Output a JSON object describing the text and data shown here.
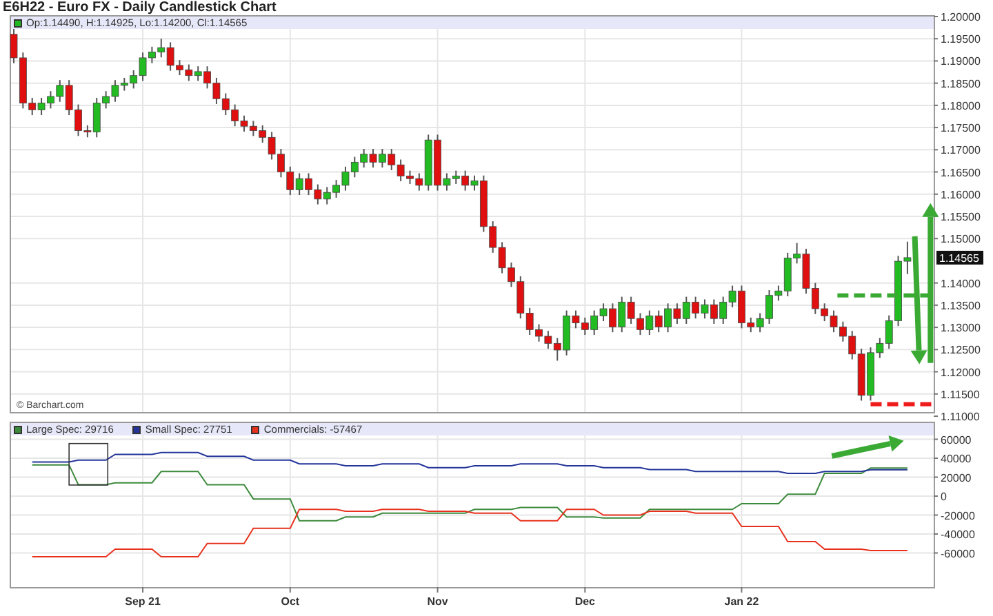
{
  "title": "E6H22 - Euro FX - Daily Candlestick Chart",
  "price_panel": {
    "legend": "Op:1.14490, H:1.14925, Lo:1.14200, Cl:1.14565",
    "credit": "© Barchart.com",
    "chart_data": {
      "type": "candlestick",
      "grid": true,
      "ylim": [
        1.11,
        1.2
      ],
      "yticks": [
        {
          "value": 1.2,
          "label": "1.20000"
        },
        {
          "value": 1.195,
          "label": "1.19500"
        },
        {
          "value": 1.19,
          "label": "1.19000"
        },
        {
          "value": 1.185,
          "label": "1.18500"
        },
        {
          "value": 1.18,
          "label": "1.18000"
        },
        {
          "value": 1.175,
          "label": "1.17500"
        },
        {
          "value": 1.17,
          "label": "1.17000"
        },
        {
          "value": 1.165,
          "label": "1.16500"
        },
        {
          "value": 1.16,
          "label": "1.16000"
        },
        {
          "value": 1.155,
          "label": "1.15500"
        },
        {
          "value": 1.15,
          "label": "1.15000"
        },
        {
          "value": 1.14,
          "label": "1.14000"
        },
        {
          "value": 1.135,
          "label": "1.13500"
        },
        {
          "value": 1.13,
          "label": "1.13000"
        },
        {
          "value": 1.125,
          "label": "1.12500"
        },
        {
          "value": 1.12,
          "label": "1.12000"
        },
        {
          "value": 1.115,
          "label": "1.11500"
        },
        {
          "value": 1.11,
          "label": "1.11000"
        }
      ],
      "ohlc": [
        [
          1.196,
          1.1975,
          1.1895,
          1.1907
        ],
        [
          1.1907,
          1.1919,
          1.1793,
          1.1805
        ],
        [
          1.1805,
          1.1817,
          1.1778,
          1.179
        ],
        [
          1.179,
          1.1817,
          1.1778,
          1.1805
        ],
        [
          1.1805,
          1.1832,
          1.1793,
          1.182
        ],
        [
          1.182,
          1.1857,
          1.1808,
          1.1845
        ],
        [
          1.1845,
          1.1857,
          1.1778,
          1.179
        ],
        [
          1.179,
          1.1802,
          1.1731,
          1.1743
        ],
        [
          1.1743,
          1.1755,
          1.1728,
          1.174
        ],
        [
          1.174,
          1.1817,
          1.1728,
          1.1805
        ],
        [
          1.1805,
          1.1832,
          1.1793,
          1.182
        ],
        [
          1.182,
          1.1857,
          1.1808,
          1.1845
        ],
        [
          1.1845,
          1.1862,
          1.1833,
          1.185
        ],
        [
          1.185,
          1.1879,
          1.1838,
          1.1867
        ],
        [
          1.1867,
          1.1919,
          1.1855,
          1.1907
        ],
        [
          1.1907,
          1.1932,
          1.1895,
          1.192
        ],
        [
          1.192,
          1.195,
          1.1908,
          1.193
        ],
        [
          1.193,
          1.1942,
          1.1878,
          1.189
        ],
        [
          1.189,
          1.1902,
          1.1868,
          1.188
        ],
        [
          1.188,
          1.1892,
          1.1855,
          1.1867
        ],
        [
          1.1867,
          1.1888,
          1.1855,
          1.1876
        ],
        [
          1.1876,
          1.1888,
          1.1838,
          1.185
        ],
        [
          1.185,
          1.1862,
          1.1803,
          1.1815
        ],
        [
          1.1815,
          1.1827,
          1.1778,
          1.179
        ],
        [
          1.179,
          1.1802,
          1.1753,
          1.1765
        ],
        [
          1.1765,
          1.1777,
          1.1741,
          1.1753
        ],
        [
          1.1753,
          1.1765,
          1.1731,
          1.1743
        ],
        [
          1.1743,
          1.1755,
          1.1716,
          1.1728
        ],
        [
          1.1728,
          1.174,
          1.1678,
          1.169
        ],
        [
          1.169,
          1.1702,
          1.1638,
          1.165
        ],
        [
          1.165,
          1.1662,
          1.1598,
          1.161
        ],
        [
          1.161,
          1.1647,
          1.1598,
          1.1635
        ],
        [
          1.1635,
          1.1647,
          1.1598,
          1.161
        ],
        [
          1.161,
          1.1622,
          1.1577,
          1.1589
        ],
        [
          1.1589,
          1.1616,
          1.1577,
          1.1604
        ],
        [
          1.1604,
          1.1632,
          1.1592,
          1.162
        ],
        [
          1.162,
          1.1662,
          1.1608,
          1.165
        ],
        [
          1.165,
          1.1684,
          1.1638,
          1.1672
        ],
        [
          1.1672,
          1.1702,
          1.166,
          1.169
        ],
        [
          1.169,
          1.1702,
          1.166,
          1.1672
        ],
        [
          1.1672,
          1.1702,
          1.166,
          1.169
        ],
        [
          1.169,
          1.1702,
          1.1654,
          1.1666
        ],
        [
          1.1666,
          1.1678,
          1.1629,
          1.1641
        ],
        [
          1.1641,
          1.1653,
          1.1623,
          1.1635
        ],
        [
          1.1635,
          1.1647,
          1.1608,
          1.162
        ],
        [
          1.162,
          1.1734,
          1.1608,
          1.1722
        ],
        [
          1.1722,
          1.1734,
          1.1608,
          1.162
        ],
        [
          1.162,
          1.1647,
          1.1608,
          1.1635
        ],
        [
          1.1635,
          1.1653,
          1.1623,
          1.1641
        ],
        [
          1.1641,
          1.1653,
          1.1608,
          1.162
        ],
        [
          1.162,
          1.1642,
          1.1608,
          1.163
        ],
        [
          1.163,
          1.1642,
          1.1515,
          1.1527
        ],
        [
          1.1527,
          1.1539,
          1.1468,
          1.148
        ],
        [
          1.148,
          1.1492,
          1.1422,
          1.1434
        ],
        [
          1.1434,
          1.1446,
          1.1391,
          1.1403
        ],
        [
          1.1403,
          1.1415,
          1.132,
          1.1332
        ],
        [
          1.1332,
          1.1344,
          1.1283,
          1.1295
        ],
        [
          1.1295,
          1.1307,
          1.1268,
          1.128
        ],
        [
          1.128,
          1.1292,
          1.1252,
          1.1264
        ],
        [
          1.1264,
          1.1276,
          1.1225,
          1.1249
        ],
        [
          1.1249,
          1.1338,
          1.1237,
          1.1326
        ],
        [
          1.1326,
          1.1338,
          1.1298,
          1.131
        ],
        [
          1.131,
          1.1322,
          1.1283,
          1.1295
        ],
        [
          1.1295,
          1.1338,
          1.1283,
          1.1326
        ],
        [
          1.1326,
          1.1354,
          1.1314,
          1.1342
        ],
        [
          1.1342,
          1.1354,
          1.1289,
          1.1301
        ],
        [
          1.1301,
          1.1369,
          1.1289,
          1.1357
        ],
        [
          1.1357,
          1.1369,
          1.1308,
          1.132
        ],
        [
          1.132,
          1.1332,
          1.1283,
          1.1295
        ],
        [
          1.1295,
          1.1338,
          1.1283,
          1.1326
        ],
        [
          1.1326,
          1.1338,
          1.1289,
          1.1301
        ],
        [
          1.1301,
          1.1354,
          1.1289,
          1.1342
        ],
        [
          1.1342,
          1.1354,
          1.1308,
          1.132
        ],
        [
          1.132,
          1.1369,
          1.1308,
          1.1357
        ],
        [
          1.1357,
          1.1369,
          1.132,
          1.1332
        ],
        [
          1.1332,
          1.1363,
          1.132,
          1.1351
        ],
        [
          1.1351,
          1.1363,
          1.1308,
          1.132
        ],
        [
          1.132,
          1.1369,
          1.1308,
          1.1357
        ],
        [
          1.1357,
          1.1394,
          1.1345,
          1.1382
        ],
        [
          1.1382,
          1.1394,
          1.1298,
          1.131
        ],
        [
          1.131,
          1.1322,
          1.1289,
          1.1301
        ],
        [
          1.1301,
          1.1332,
          1.1289,
          1.132
        ],
        [
          1.132,
          1.1384,
          1.1308,
          1.1372
        ],
        [
          1.1372,
          1.1394,
          1.136,
          1.1382
        ],
        [
          1.1382,
          1.1468,
          1.137,
          1.1456
        ],
        [
          1.1456,
          1.149,
          1.1444,
          1.1465
        ],
        [
          1.1465,
          1.1477,
          1.1376,
          1.1388
        ],
        [
          1.1388,
          1.14,
          1.133,
          1.1342
        ],
        [
          1.1342,
          1.1354,
          1.1314,
          1.1326
        ],
        [
          1.1326,
          1.1338,
          1.1289,
          1.1301
        ],
        [
          1.1301,
          1.1313,
          1.1268,
          1.128
        ],
        [
          1.128,
          1.1292,
          1.1228,
          1.124
        ],
        [
          1.124,
          1.1252,
          1.1135,
          1.1147
        ],
        [
          1.1147,
          1.1255,
          1.1135,
          1.1243
        ],
        [
          1.1243,
          1.1276,
          1.1231,
          1.1264
        ],
        [
          1.1264,
          1.1327,
          1.1252,
          1.1315
        ],
        [
          1.1315,
          1.1461,
          1.1303,
          1.1449
        ],
        [
          1.1449,
          1.1493,
          1.142,
          1.1457
        ]
      ]
    },
    "markup": [
      {
        "kind": "dashed_line",
        "color": "#3aaa35"
      },
      {
        "kind": "dashed_line",
        "color": "#ee1c1c"
      },
      {
        "kind": "arrow",
        "color": "#3aaa35"
      },
      {
        "kind": "arrow",
        "color": "#3aaa35"
      }
    ],
    "price_tag": "1.14565"
  },
  "cot_panel": {
    "legend": [
      "Large Spec: 29716",
      "Small Spec: 27751",
      "Commercials: -57467"
    ],
    "chart_data": {
      "type": "line",
      "grid": true,
      "ylim": [
        -96000,
        64000
      ],
      "categories": [
        null,
        null,
        null,
        null,
        null,
        null,
        null,
        null,
        null,
        null,
        null,
        null,
        null,
        null,
        "Sep 21",
        null,
        null,
        null,
        null,
        null,
        null,
        null,
        null,
        null,
        null,
        null,
        null,
        null,
        null,
        null,
        "Oct",
        null,
        null,
        null,
        null,
        null,
        null,
        null,
        null,
        null,
        null,
        null,
        null,
        null,
        null,
        null,
        "Nov",
        null,
        null,
        null,
        null,
        null,
        null,
        null,
        null,
        null,
        null,
        null,
        null,
        null,
        null,
        null,
        "Dec",
        null,
        null,
        null,
        null,
        null,
        null,
        null,
        null,
        null,
        null,
        null,
        null,
        null,
        null,
        null,
        null,
        "Jan 22",
        null,
        null,
        null,
        null,
        null,
        null,
        null,
        null,
        null,
        null,
        null,
        null,
        null,
        null,
        null,
        null,
        null,
        null
      ],
      "yticks": [
        60000,
        40000,
        20000,
        0,
        -20000,
        -40000,
        -60000
      ],
      "series": [
        {
          "color": "#3c8a3c",
          "values": [
            null,
            null,
            33000,
            33000,
            33000,
            33000,
            33000,
            12000,
            12000,
            12000,
            12000,
            14000,
            14000,
            14000,
            14000,
            14000,
            26000,
            26000,
            26000,
            26000,
            26000,
            12000,
            12000,
            12000,
            12000,
            12000,
            -3000,
            -3000,
            -3000,
            -3000,
            -3000,
            -26000,
            -26000,
            -26000,
            -26000,
            -26000,
            -22000,
            -22000,
            -22000,
            -22000,
            -18000,
            -18000,
            -18000,
            -18000,
            -18000,
            -18000,
            -18000,
            -18000,
            -18000,
            -18000,
            -14000,
            -14000,
            -14000,
            -14000,
            -14000,
            -12000,
            -12000,
            -12000,
            -12000,
            -12000,
            -22000,
            -22000,
            -22000,
            -22000,
            -23000,
            -23000,
            -23000,
            -23000,
            -23000,
            -14000,
            -14000,
            -14000,
            -14000,
            -14000,
            -14000,
            -14000,
            -14000,
            -14000,
            -14000,
            -8000,
            -8000,
            -8000,
            -8000,
            -8000,
            2000,
            2000,
            2000,
            2000,
            24000,
            24000,
            24000,
            24000,
            24000,
            29716,
            29716,
            29716,
            29716,
            29716
          ]
        },
        {
          "color": "#23359a",
          "values": [
            null,
            null,
            36000,
            36000,
            36000,
            36000,
            36000,
            38000,
            38000,
            38000,
            38000,
            44000,
            44000,
            44000,
            44000,
            44000,
            46000,
            46000,
            46000,
            46000,
            46000,
            42000,
            42000,
            42000,
            42000,
            42000,
            38000,
            38000,
            38000,
            38000,
            38000,
            34000,
            34000,
            34000,
            34000,
            34000,
            32000,
            32000,
            32000,
            32000,
            34000,
            34000,
            34000,
            34000,
            34000,
            30000,
            30000,
            30000,
            30000,
            30000,
            32000,
            32000,
            32000,
            32000,
            32000,
            34000,
            34000,
            34000,
            34000,
            34000,
            32000,
            32000,
            32000,
            32000,
            30000,
            30000,
            30000,
            30000,
            30000,
            28000,
            28000,
            28000,
            28000,
            28000,
            26000,
            26000,
            26000,
            26000,
            26000,
            26000,
            26000,
            26000,
            26000,
            26000,
            24000,
            24000,
            24000,
            24000,
            26000,
            26000,
            26000,
            26000,
            26000,
            27751,
            27751,
            27751,
            27751,
            27751
          ]
        },
        {
          "color": "#e8321e",
          "values": [
            null,
            null,
            -64000,
            -64000,
            -64000,
            -64000,
            -64000,
            -64000,
            -64000,
            -64000,
            -64000,
            -56000,
            -56000,
            -56000,
            -56000,
            -56000,
            -64000,
            -64000,
            -64000,
            -64000,
            -64000,
            -50000,
            -50000,
            -50000,
            -50000,
            -50000,
            -34000,
            -34000,
            -34000,
            -34000,
            -34000,
            -14000,
            -14000,
            -14000,
            -14000,
            -14000,
            -16000,
            -16000,
            -16000,
            -16000,
            -14000,
            -14000,
            -14000,
            -14000,
            -14000,
            -16000,
            -16000,
            -16000,
            -16000,
            -16000,
            -18000,
            -18000,
            -18000,
            -18000,
            -18000,
            -26000,
            -26000,
            -26000,
            -26000,
            -26000,
            -14000,
            -14000,
            -14000,
            -14000,
            -20000,
            -20000,
            -20000,
            -20000,
            -20000,
            -16000,
            -16000,
            -16000,
            -16000,
            -16000,
            -18000,
            -18000,
            -18000,
            -18000,
            -18000,
            -32000,
            -32000,
            -32000,
            -32000,
            -32000,
            -48000,
            -48000,
            -48000,
            -48000,
            -56000,
            -56000,
            -56000,
            -56000,
            -56000,
            -57467,
            -57467,
            -57467,
            -57467,
            -57467
          ]
        }
      ]
    },
    "markup": [
      {
        "kind": "box",
        "color": "#333333"
      },
      {
        "kind": "arrow",
        "color": "#3aaa35"
      }
    ]
  }
}
